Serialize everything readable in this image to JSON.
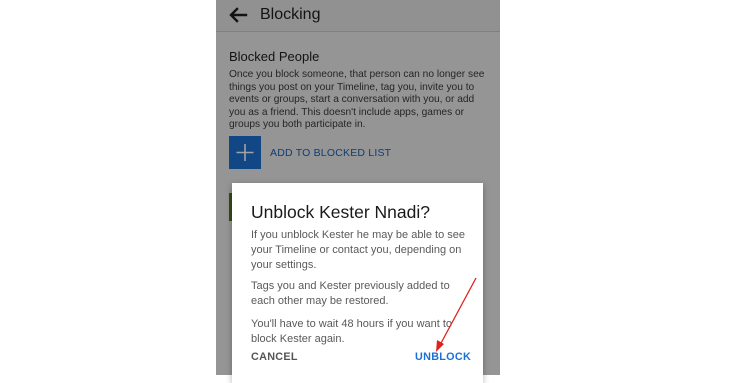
{
  "app_bar": {
    "title": "Blocking",
    "back_icon": "arrow-left-icon"
  },
  "blocked_people": {
    "title": "Blocked People",
    "description": "Once you block someone, that person can no longer see things you post on your Timeline, tag you, invite you to events or groups, start a conversation with you, or add you as a friend. This doesn't include apps, games or groups you both participate in.",
    "add_icon": "plus-icon",
    "add_label": "ADD TO BLOCKED LIST"
  },
  "dialog": {
    "title": "Unblock Kester Nnadi?",
    "paragraphs": [
      "If you unblock Kester he may be able to see your Timeline or contact you, depending on your settings.",
      "Tags you and Kester previously added to each other may be restored.",
      "You'll have to wait 48 hours if you want to block Kester again."
    ],
    "cancel_label": "CANCEL",
    "unblock_label": "UNBLOCK"
  },
  "colors": {
    "accent": "#1a72d6",
    "annotation_arrow": "#e0201b"
  }
}
